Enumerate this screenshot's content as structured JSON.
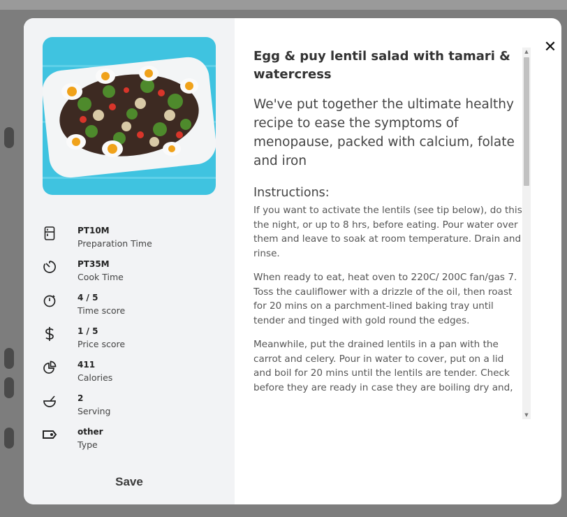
{
  "recipe": {
    "title": "Egg & puy lentil salad with tamari & watercress",
    "description": "We've put together the ultimate healthy recipe to ease the symptoms of menopause, packed with calcium, folate and iron",
    "instructions_heading": "Instructions:",
    "steps": [
      "If you want to activate the lentils (see tip below), do this the night, or up to 8 hrs, before eating. Pour water over them and leave to soak at room temperature. Drain and rinse.",
      "When ready to eat, heat oven to 220C/ 200C fan/gas 7. Toss the cauliflower with a drizzle of the oil, then roast for 20 mins on a parchment-lined baking tray until tender and tinged with gold round the edges.",
      "Meanwhile, put the drained lentils in a pan with the carrot and celery. Pour in water to cover, put on a lid and boil for 20 mins until the lentils are tender. Check before they are ready in case they are boiling dry and,"
    ]
  },
  "meta": [
    {
      "icon": "fridge-icon",
      "value": "PT10M",
      "label": "Preparation Time"
    },
    {
      "icon": "timer-icon",
      "value": "PT35M",
      "label": "Cook Time"
    },
    {
      "icon": "stopwatch-icon",
      "value": "4 / 5",
      "label": "Time score"
    },
    {
      "icon": "dollar-icon",
      "value": "1 / 5",
      "label": "Price score"
    },
    {
      "icon": "pie-chart-icon",
      "value": "411",
      "label": "Calories"
    },
    {
      "icon": "bowl-icon",
      "value": "2",
      "label": "Serving"
    },
    {
      "icon": "tag-icon",
      "value": "other",
      "label": "Type"
    }
  ],
  "actions": {
    "save_label": "Save",
    "close_glyph": "✕"
  },
  "colors": {
    "photo_background": "#3fc3e0",
    "panel_background": "#f2f3f5"
  }
}
